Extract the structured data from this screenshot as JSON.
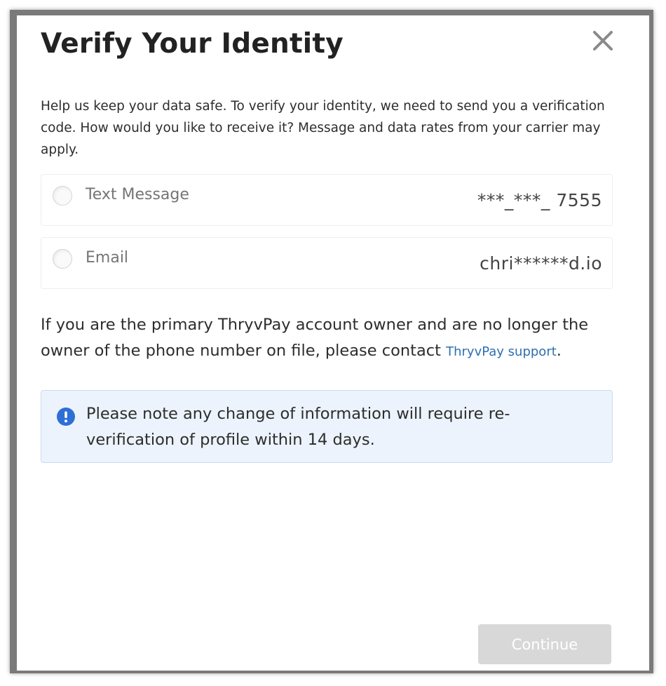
{
  "dialog": {
    "title": "Verify Your Identity",
    "close_icon": "close-icon",
    "intro": "Help us keep your data safe. To verify your identity, we need to send you a verification code. How would you like to receive it? Message and data rates from your carrier may apply.",
    "options": [
      {
        "label": "Text Message",
        "value": "***_***_ 7555",
        "selected": false
      },
      {
        "label": "Email",
        "value": "chri******d.io",
        "selected": false
      }
    ],
    "owner_note": "If you are the primary ThryvPay account owner and are no longer the owner of the phone number on file, please contact ",
    "support_link": "ThryvPay support",
    "owner_note_end": ".",
    "notice": {
      "icon": "info-icon",
      "text": "Please note any change of information will require re-verification of profile within 14 days."
    },
    "continue_label": "Continue",
    "colors": {
      "accent": "#2e6fb0",
      "notice_bg": "#ecf3fc",
      "notice_border": "#cbdcf1",
      "button_disabled": "#d8d8d8"
    }
  }
}
